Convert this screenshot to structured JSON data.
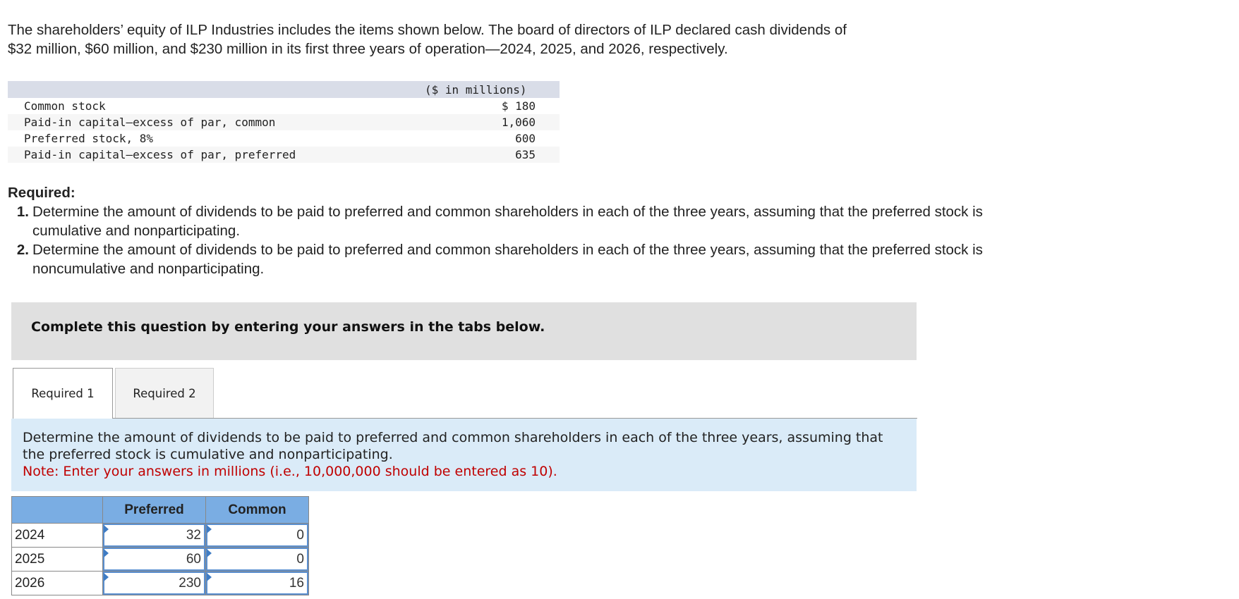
{
  "intro": {
    "line1": "The shareholders’ equity of ILP Industries includes the items shown below. The board of directors of ILP declared cash dividends of",
    "line2": "$32 million, $60 million, and $230 million in its first three years of operation—2024, 2025, and 2026, respectively."
  },
  "equity": {
    "header": "($ in millions)",
    "rows": [
      {
        "label": "Common stock",
        "value": "$ 180"
      },
      {
        "label": "Paid-in capital—excess of par, common",
        "value": "1,060"
      },
      {
        "label": "Preferred stock, 8%",
        "value": "600"
      },
      {
        "label": "Paid-in capital—excess of par, preferred",
        "value": "635"
      }
    ]
  },
  "required": {
    "title": "Required:",
    "items": [
      {
        "num": "1.",
        "text": "Determine the amount of dividends to be paid to preferred and common shareholders in each of the three years, assuming that the preferred stock is cumulative and nonparticipating."
      },
      {
        "num": "2.",
        "text": "Determine the amount of dividends to be paid to preferred and common shareholders in each of the three years, assuming that the preferred stock is noncumulative and nonparticipating."
      }
    ]
  },
  "instruction": "Complete this question by entering your answers in the tabs below.",
  "tabs": [
    {
      "label": "Required 1",
      "active": true
    },
    {
      "label": "Required 2",
      "active": false
    }
  ],
  "panel": {
    "text": "Determine the amount of dividends to be paid to preferred and common shareholders in each of the three years, assuming that the preferred stock is cumulative and nonparticipating.",
    "note": "Note: Enter your answers in millions (i.e., 10,000,000 should be entered as 10)."
  },
  "answer_table": {
    "headers": [
      "",
      "Preferred",
      "Common"
    ],
    "rows": [
      {
        "year": "2024",
        "preferred": "32",
        "common": "0"
      },
      {
        "year": "2025",
        "preferred": "60",
        "common": "0"
      },
      {
        "year": "2026",
        "preferred": "230",
        "common": "16"
      }
    ]
  },
  "colors": {
    "table_header": "#7aade3",
    "panel_bg": "#daebf8",
    "note_red": "#c00000",
    "instruction_bg": "#e0e0e0"
  }
}
